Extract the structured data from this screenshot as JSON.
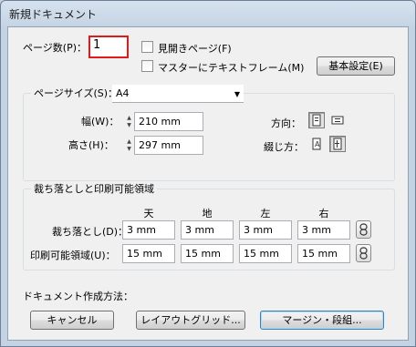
{
  "window": {
    "title": "新規ドキュメント"
  },
  "pages": {
    "label": "ページ数(P)：",
    "value": "1",
    "facing_pages_label": "見開きページ(F)",
    "master_text_frame_label": "マスターにテキストフレーム(M)",
    "basic_settings_button": "基本設定(E)"
  },
  "page_size": {
    "group_label": "ページサイズ(S)：",
    "selected": "A4",
    "width_label": "幅(W)：",
    "width_value": "210 mm",
    "height_label": "高さ(H)：",
    "height_value": "297 mm",
    "orientation_label": "方向：",
    "binding_label": "綴じ方："
  },
  "bleed": {
    "group_label": "裁ち落としと印刷可能領域",
    "columns": [
      "天",
      "地",
      "左",
      "右"
    ],
    "bleed_label": "裁ち落とし(D)：",
    "bleed_values": [
      "3 mm",
      "3 mm",
      "3 mm",
      "3 mm"
    ],
    "slug_label": "印刷可能領域(U)：",
    "slug_values": [
      "15 mm",
      "15 mm",
      "15 mm",
      "15 mm"
    ]
  },
  "footer": {
    "method_label": "ドキュメント作成方法：",
    "cancel_button": "キャンセル",
    "layout_grid_button": "レイアウトグリッド...",
    "margin_columns_button": "マージン・段組..."
  }
}
